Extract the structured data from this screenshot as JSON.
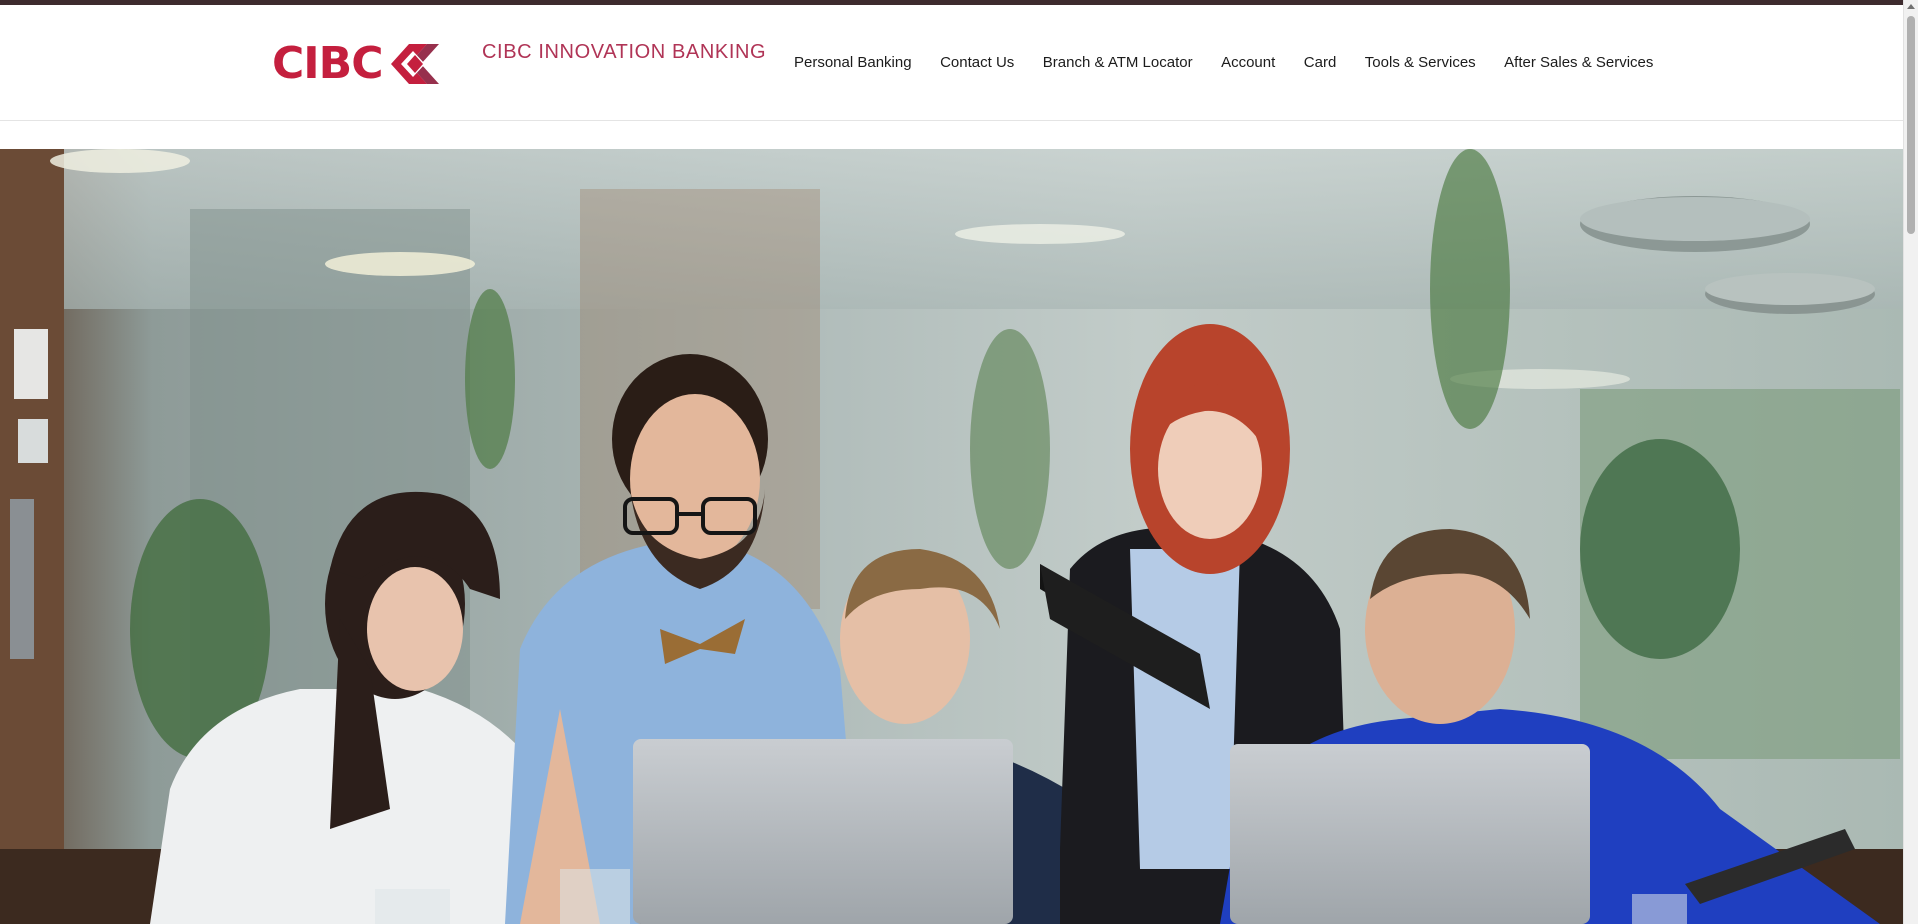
{
  "brand": {
    "logo_text": "CIBC",
    "logo_icon": "cibc-diamond-icon",
    "sub_brand": "CIBC INNOVATION BANKING",
    "accent_color": "#c41f3e",
    "sub_brand_color": "#b03456"
  },
  "nav": {
    "items": [
      {
        "label": "Personal Banking"
      },
      {
        "label": "Contact Us"
      },
      {
        "label": "Branch & ATM Locator"
      },
      {
        "label": "Account"
      },
      {
        "label": "Card"
      },
      {
        "label": "Tools & Services"
      },
      {
        "label": "After Sales & Services"
      }
    ]
  },
  "hero": {
    "image_icon": "team-at-laptops-photo"
  },
  "scrollbar": {
    "icon": "scroll-up-arrow-icon"
  }
}
